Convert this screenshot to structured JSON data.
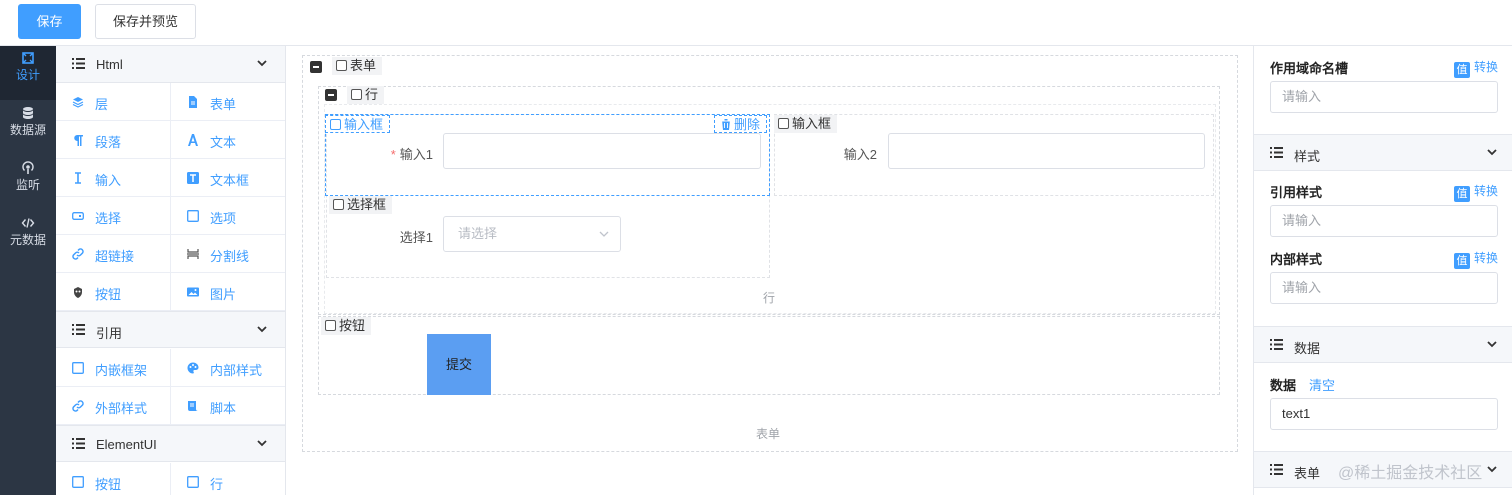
{
  "toolbar": {
    "save_label": "保存",
    "save_preview_label": "保存并预览"
  },
  "nav": [
    {
      "label": "设计",
      "icon": "design-icon"
    },
    {
      "label": "数据源",
      "icon": "database-icon"
    },
    {
      "label": "监听",
      "icon": "listen-icon"
    },
    {
      "label": "元数据",
      "icon": "code-icon"
    }
  ],
  "palette": {
    "groups": [
      {
        "title": "Html",
        "items": [
          {
            "label": "层",
            "icon": "layers-icon"
          },
          {
            "label": "表单",
            "icon": "document-icon"
          },
          {
            "label": "段落",
            "icon": "paragraph-icon"
          },
          {
            "label": "文本",
            "icon": "text-icon"
          },
          {
            "label": "输入",
            "icon": "text-cursor-icon"
          },
          {
            "label": "文本框",
            "icon": "textarea-icon"
          },
          {
            "label": "选择",
            "icon": "select-icon"
          },
          {
            "label": "选项",
            "icon": "checkbox-icon"
          },
          {
            "label": "超链接",
            "icon": "link-icon"
          },
          {
            "label": "分割线",
            "icon": "divider-icon"
          },
          {
            "label": "按钮",
            "icon": "button-icon"
          },
          {
            "label": "图片",
            "icon": "image-icon"
          }
        ]
      },
      {
        "title": "引用",
        "items": [
          {
            "label": "内嵌框架",
            "icon": "iframe-icon"
          },
          {
            "label": "内部样式",
            "icon": "palette-icon"
          },
          {
            "label": "外部样式",
            "icon": "link-icon"
          },
          {
            "label": "脚本",
            "icon": "script-icon"
          }
        ]
      },
      {
        "title": "ElementUI",
        "items": [
          {
            "label": "按钮",
            "icon": "checkbox-icon"
          },
          {
            "label": "行",
            "icon": "checkbox-icon"
          }
        ]
      }
    ]
  },
  "canvas": {
    "form_tag": "表单",
    "row_tag": "行",
    "input_box_tag_1": "输入框",
    "delete_label": "删除",
    "input_box_tag_2": "输入框",
    "input1_label": "输入1",
    "input2_label": "输入2",
    "select_box_tag": "选择框",
    "select1_label": "选择1",
    "select_placeholder": "请选择",
    "row_caption": "行",
    "button_tag": "按钮",
    "submit_label": "提交",
    "form_caption": "表单"
  },
  "props": {
    "scope_slot_title": "作用域命名槽",
    "convert_label": "转换",
    "value_badge": "值",
    "input_placeholder": "请输入",
    "style_section": "样式",
    "ref_style_title": "引用样式",
    "inner_style_title": "内部样式",
    "data_section": "数据",
    "data_title": "数据",
    "clear_label": "清空",
    "data_value": "text1",
    "form_section": "表单"
  },
  "watermark": "@稀土掘金技术社区",
  "colors": {
    "primary": "#409eff",
    "nav_bg": "#2c3644",
    "danger": "#f56c6c"
  }
}
